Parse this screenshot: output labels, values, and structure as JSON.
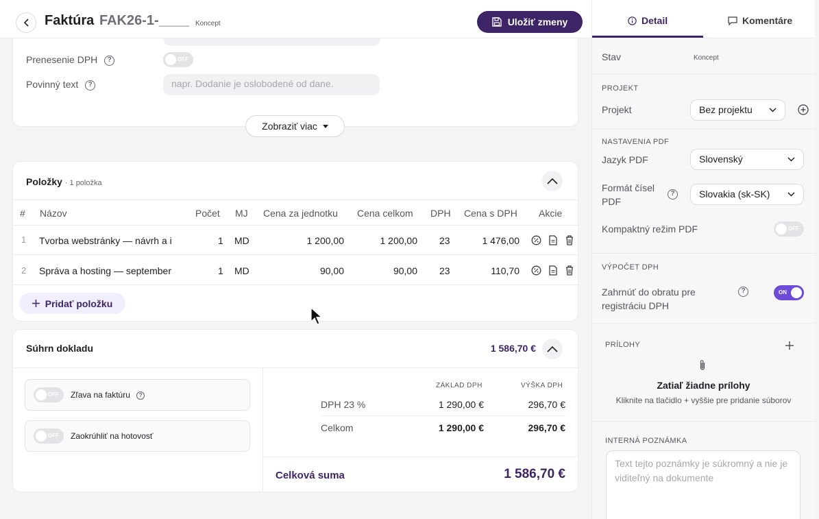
{
  "header": {
    "title": "Faktúra",
    "doc_number": "FAK26-1-____",
    "status": "Koncept",
    "save_label": "Uložiť zmeny"
  },
  "settings_card": {
    "reverse_charge_label": "Prenesenie DPH",
    "reverse_charge_toggle": "OFF",
    "mandatory_text_label": "Povinný text",
    "mandatory_text_placeholder": "napr. Dodanie je oslobodené od dane.",
    "show_more_label": "Zobraziť viac"
  },
  "items": {
    "title": "Položky",
    "count_label": "· 1 položka",
    "columns": [
      "#",
      "Názov",
      "Počet",
      "MJ",
      "Cena za jednotku",
      "Cena celkom",
      "DPH",
      "Cena s DPH",
      "Akcie"
    ],
    "rows": [
      {
        "num": "1",
        "name": "Tvorba webstránky — návrh a i",
        "qty": "1",
        "unit": "MD",
        "unit_price": "1 200,00",
        "total": "1 200,00",
        "vat": "23",
        "total_vat": "1 476,00"
      },
      {
        "num": "2",
        "name": "Správa a hosting — september",
        "qty": "1",
        "unit": "MD",
        "unit_price": "90,00",
        "total": "90,00",
        "vat": "23",
        "total_vat": "110,70"
      }
    ],
    "add_label": "Pridať položku"
  },
  "summary": {
    "title": "Súhrn dokladu",
    "total_header": "1 586,70 €",
    "discount_label": "Zľava na faktúru",
    "discount_toggle": "OFF",
    "rounding_label": "Zaokrúhliť na hotovosť",
    "rounding_toggle": "OFF",
    "col_base": "ZÁKLAD DPH",
    "col_vat": "VÝŠKA DPH",
    "rows": [
      {
        "label": "DPH 23 %",
        "base": "1 290,00 €",
        "vat": "296,70 €"
      },
      {
        "label": "Celkom",
        "base": "1 290,00 €",
        "vat": "296,70 €"
      }
    ],
    "grand_label": "Celková suma",
    "grand_value": "1 586,70 €"
  },
  "panel": {
    "tab_detail": "Detail",
    "tab_comments": "Komentáre",
    "status_label": "Stav",
    "status_value": "Koncept",
    "project_section": "PROJEKT",
    "project_label": "Projekt",
    "project_value": "Bez projektu",
    "pdf_section": "NASTAVENIA PDF",
    "pdf_lang_label": "Jazyk PDF",
    "pdf_lang_value": "Slovenský",
    "number_format_label_1": "Formát čísel",
    "number_format_label_2": "PDF",
    "number_format_value": "Slovakia (sk-SK)",
    "compact_label": "Kompaktný režim PDF",
    "compact_toggle": "OFF",
    "vat_section": "VÝPOČET DPH",
    "vat_turnover_label_1": "Zahrnúť do obratu pre",
    "vat_turnover_label_2": "registráciu DPH",
    "vat_turnover_toggle": "ON",
    "attachments_section": "PRÍLOHY",
    "attachments_empty_title": "Zatiaľ žiadne prílohy",
    "attachments_empty_hint": "Kliknite na tlačidlo + vyššie pre pridanie súborov",
    "note_section": "INTERNÁ POZNÁMKA",
    "note_placeholder": "Text tejto poznámky je súkromný a nie je viditeľný na dokumente"
  },
  "colors": {
    "accent": "#3d2466",
    "toggle_on": "#6c4bd8"
  }
}
